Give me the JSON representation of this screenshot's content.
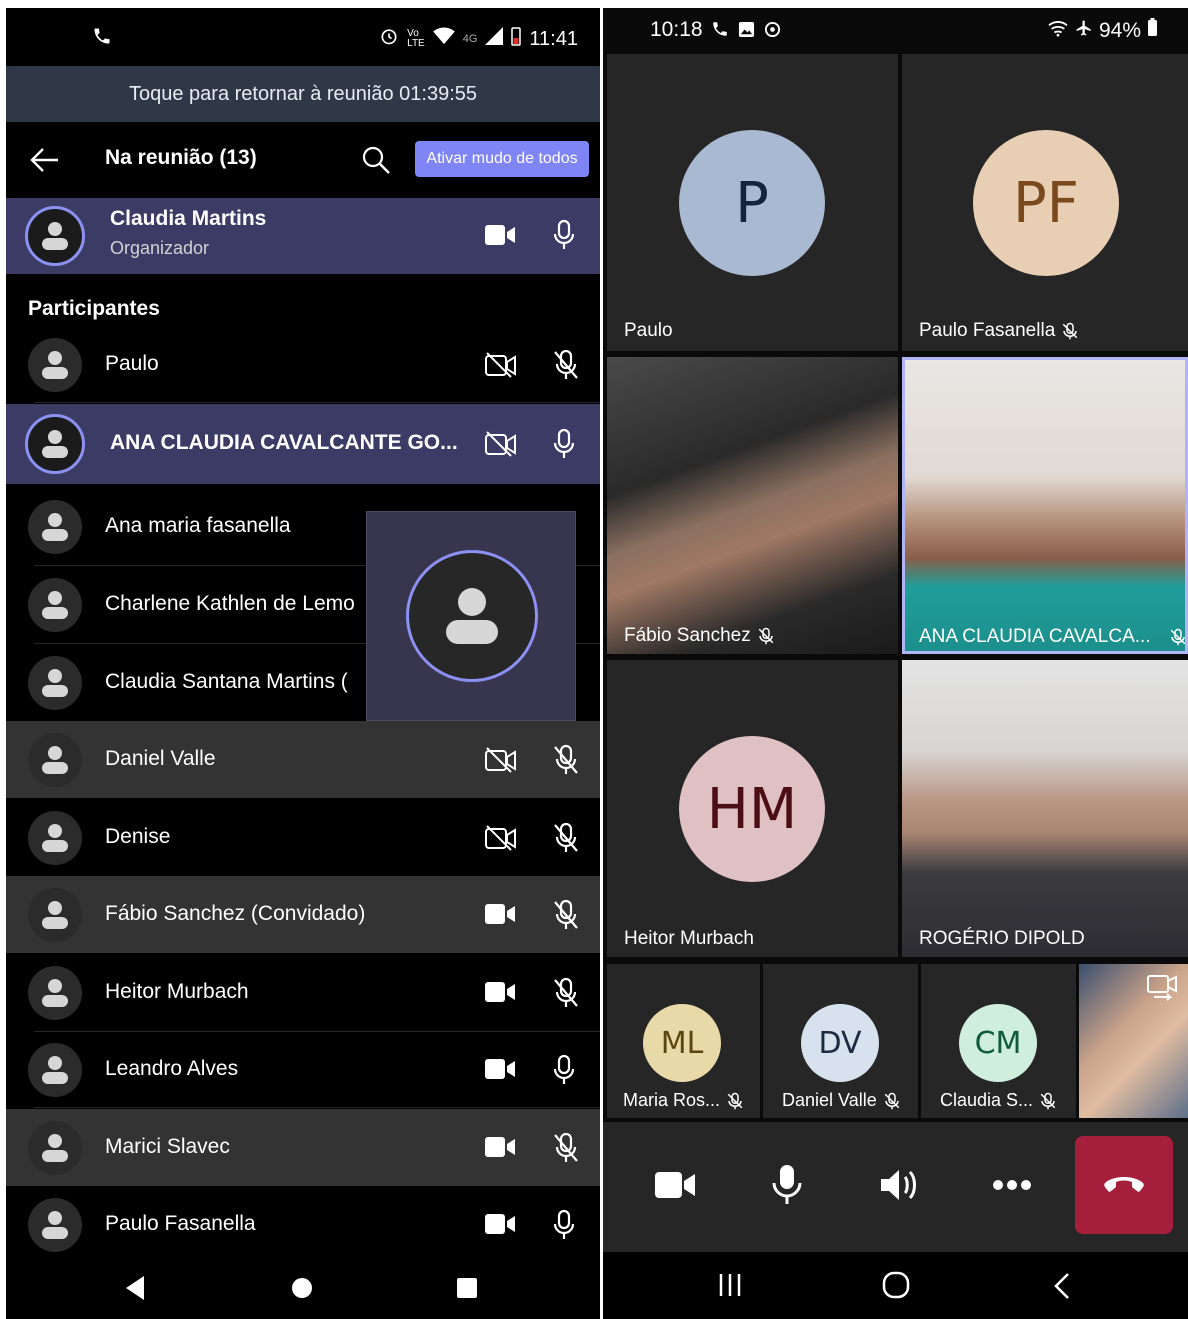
{
  "left_phone": {
    "status_bar": {
      "time": "11:41"
    },
    "banner": {
      "text": "Toque para retornar à reunião 01:39:55"
    },
    "header": {
      "title": "Na reunião (13)",
      "mute_all_label": "Ativar mudo de todos"
    },
    "organizer": {
      "name": "Claudia Martins",
      "role": "Organizador"
    },
    "section_label": "Participantes",
    "participants": [
      {
        "name": "Paulo",
        "video": "off",
        "mic": "muted"
      },
      {
        "name": "ANA CLAUDIA CAVALCANTE GO...",
        "video": "off",
        "mic": "on",
        "speaking": true
      },
      {
        "name": "Ana maria fasanella"
      },
      {
        "name": "Charlene Kathlen de Lemo"
      },
      {
        "name": "Claudia Santana Martins ("
      },
      {
        "name": "Daniel Valle",
        "video": "off",
        "mic": "muted"
      },
      {
        "name": "Denise",
        "video": "off",
        "mic": "muted"
      },
      {
        "name": "Fábio Sanchez (Convidado)",
        "video": "on",
        "mic": "muted"
      },
      {
        "name": "Heitor Murbach",
        "video": "on",
        "mic": "muted"
      },
      {
        "name": "Leandro Alves",
        "video": "on",
        "mic": "on"
      },
      {
        "name": "Marici Slavec",
        "video": "on",
        "mic": "muted"
      },
      {
        "name": "Paulo Fasanella",
        "video": "on",
        "mic": "on"
      }
    ],
    "colors": {
      "accent": "#7f85f5",
      "highlight": "#3b3b66",
      "banner": "#2e3847"
    }
  },
  "right_phone": {
    "status_bar": {
      "time": "10:18",
      "battery": "94%"
    },
    "tiles": {
      "paulo": {
        "initials": "P",
        "name": "Paulo"
      },
      "paulo_fasanella": {
        "initials": "PF",
        "name": "Paulo Fasanella"
      },
      "fabio": {
        "name": "Fábio Sanchez"
      },
      "ana": {
        "name": "ANA CLAUDIA CAVALCA..."
      },
      "heitor": {
        "initials": "HM",
        "name": "Heitor Murbach"
      },
      "rogerio": {
        "name": "ROGÉRIO DIPOLD"
      },
      "maria": {
        "initials": "ML",
        "name": "Maria Ros..."
      },
      "daniel": {
        "initials": "DV",
        "name": "Daniel Valle"
      },
      "claudia": {
        "initials": "CM",
        "name": "Claudia S..."
      }
    },
    "colors": {
      "hangup": "#a51f3c",
      "tile_bg": "#262626"
    }
  }
}
